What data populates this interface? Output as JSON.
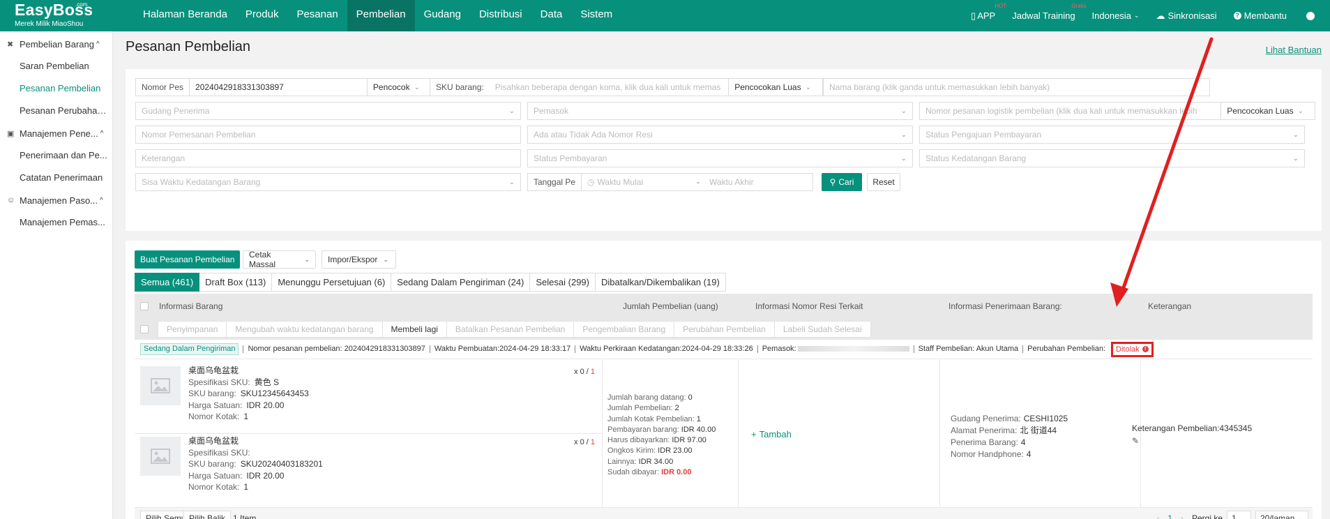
{
  "brand": {
    "name": "EasyBoss",
    "com": ".com",
    "subtitle": "Merek Milik MiaoShou"
  },
  "nav": [
    "Halaman Beranda",
    "Produk",
    "Pesanan",
    "Pembelian",
    "Gudang",
    "Distribusi",
    "Data",
    "Sistem"
  ],
  "nav_active": "Pembelian",
  "right_nav": {
    "app": "APP",
    "app_badge": "HOT",
    "training": "Jadwal Training",
    "training_badge": "Gratis",
    "language": "Indonesia",
    "sync": "Sinkronisasi",
    "help": "Membantu"
  },
  "sidebar": {
    "group1": "Pembelian Barang",
    "group1_items": [
      "Saran Pembelian",
      "Pesanan Pembelian",
      "Pesanan Perubahan..."
    ],
    "group2": "Manajemen Pene...",
    "group2_items": [
      "Penerimaan dan Pe...",
      "Catatan Penerimaan"
    ],
    "group3": "Manajemen Paso...",
    "group3_items": [
      "Manajemen Pemas..."
    ]
  },
  "page": {
    "title": "Pesanan Pembelian",
    "help_link": "Lihat Bantuan"
  },
  "filters": {
    "order_no_label": "Nomor Pes",
    "order_no_value": "2024042918331303897",
    "order_no_match": "Pencocok",
    "sku_label": "SKU barang:",
    "sku_placeholder": "Pisahkan beberapa dengan koma, klik dua kali untuk memas",
    "sku_match": "Pencocokan Luas",
    "product_name_placeholder": "Nama barang (klik ganda untuk memasukkan lebih banyak)",
    "warehouse_placeholder": "Gudang Penerima",
    "supplier_placeholder": "Pemasok",
    "logistics_placeholder": "Nomor pesanan logistik pembelian (klik dua kali untuk memasukkan lebih",
    "logistics_match": "Pencocokan Luas",
    "purchase_order_placeholder": "Nomor Pemesanan Pembelian",
    "tracking_placeholder": "Ada atau Tidak Ada Nomor Resi",
    "payment_submit_placeholder": "Status Pengajuan Pembayaran",
    "remarks_placeholder": "Keterangan",
    "payment_status_placeholder": "Status Pembayaran",
    "arrival_status_placeholder": "Status Kedatangan Barang",
    "remaining_time_placeholder": "Sisa Waktu Kedatangan Barang",
    "date_label": "Tanggal Pe",
    "start_placeholder": "Waktu Mulai",
    "date_sep": "-",
    "end_placeholder": "Waktu Akhir",
    "search_button": "Cari",
    "reset_button": "Reset"
  },
  "toolbar": {
    "create": "Buat Pesanan Pembelian",
    "print": "Cetak Massal",
    "import": "Impor/Ekspor"
  },
  "tabs": [
    "Semua (461)",
    "Draft Box (113)",
    "Menunggu Persetujuan (6)",
    "Sedang Dalam Pengiriman (24)",
    "Selesai (299)",
    "Dibatalkan/Dikembalikan (19)"
  ],
  "table_headers": {
    "info": "Informasi Barang",
    "amount": "Jumlah Pembelian (uang)",
    "tracking": "Informasi Nomor Resi Terkait",
    "receive": "Informasi Penerimaan Barang:",
    "remarks": "Keterangan"
  },
  "actions": [
    "Penyimpanan",
    "Mengubah waktu kedatangan barang",
    "Membeli lagi",
    "Batalkan Pesanan Pembelian",
    "Pengembalian Barang",
    "Perubahan Pembelian",
    "Labeli Sudah Selesai"
  ],
  "order": {
    "status": "Sedang Dalam Pengiriman",
    "order_number": "Nomor pesanan pembelian: 2024042918331303897",
    "created": "Waktu Pembuatan:2024-04-29 18:33:17",
    "eta": "Waktu Perkiraan Kedatangan:2024-04-29 18:33:26",
    "supplier": "Pemasok:",
    "staff": "Staff Pembelian: Akun Utama",
    "change": "Perubahan Pembelian:",
    "change_status": "Ditolak"
  },
  "items": [
    {
      "name": "桌面乌龟盆栽",
      "spec_label": "Spesifikasi SKU:",
      "spec": "黄色 S",
      "sku_label": "SKU barang:",
      "sku": "SKU12345643453",
      "price_label": "Harga Satuan:",
      "price": "IDR 20.00",
      "box_label": "Nomor Kotak:",
      "box": "1",
      "qty_prefix": "x",
      "qty_a": "0",
      "qty_sep": "/",
      "qty_b": "1"
    },
    {
      "name": "桌面乌龟盆栽",
      "spec_label": "Spesifikasi SKU:",
      "spec": "",
      "sku_label": "SKU barang:",
      "sku": "SKU20240403183201",
      "price_label": "Harga Satuan:",
      "price": "IDR 20.00",
      "box_label": "Nomor Kotak:",
      "box": "1",
      "qty_prefix": "x",
      "qty_a": "0",
      "qty_sep": "/",
      "qty_b": "1"
    }
  ],
  "summary": [
    {
      "label": "Jumlah barang datang:",
      "value": "0"
    },
    {
      "label": "Jumlah Pembelian:",
      "value": "2"
    },
    {
      "label": "Jumlah Kotak Pembelian:",
      "value": "1"
    },
    {
      "label": "Pembayaran barang:",
      "value": "IDR 40.00"
    },
    {
      "label": "Harus dibayarkan:",
      "value": "IDR 97.00"
    },
    {
      "label": "Ongkos Kirim:",
      "value": "IDR 23.00"
    },
    {
      "label": "Lainnya:",
      "value": "IDR 34.00"
    },
    {
      "label": "Sudah dibayar:",
      "value": "IDR 0.00"
    }
  ],
  "tracking_add": "Tambah",
  "receive": [
    {
      "label": "Gudang Penerima:",
      "value": "CESHI1025"
    },
    {
      "label": "Alamat Penerima:",
      "value": "北  街道44"
    },
    {
      "label": "Penerima Barang:",
      "value": "4"
    },
    {
      "label": "Nomor Handphone:",
      "value": "4"
    }
  ],
  "remarks": {
    "text": "Keterangan Pembelian:4345345"
  },
  "footer": {
    "select_all": "Pilih Semua",
    "invert": "Pilih Balik",
    "count": "1 Item",
    "page": "1",
    "goto_label": "Pergi ke",
    "goto_value": "1",
    "per_page": "20/laman"
  },
  "colors": {
    "brand": "#07917d",
    "highlight": "#e02020"
  }
}
